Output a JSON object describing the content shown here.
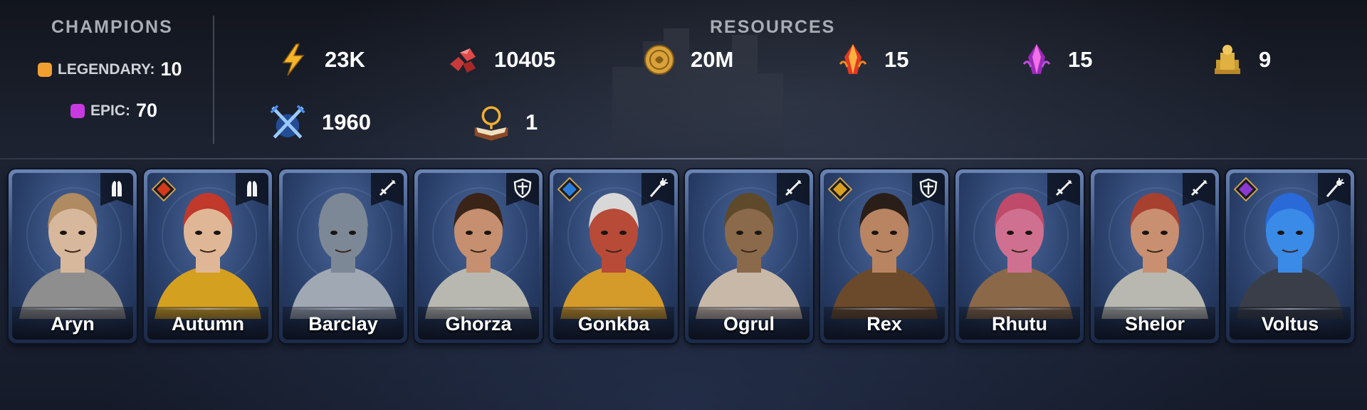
{
  "champions": {
    "title": "CHAMPIONS",
    "rarities": [
      {
        "label": "LEGENDARY:",
        "count": "10",
        "color": "#f0a030"
      },
      {
        "label": "EPIC:",
        "count": "70",
        "color": "#c73ae0"
      }
    ]
  },
  "resources": {
    "title": "RESOURCES",
    "items": [
      {
        "icon": "energy-bolt-icon",
        "value": "23K"
      },
      {
        "icon": "ruby-gems-icon",
        "value": "10405"
      },
      {
        "icon": "gold-coin-icon",
        "value": "20M"
      },
      {
        "icon": "fire-crystal-icon",
        "value": "15"
      },
      {
        "icon": "void-crystal-icon",
        "value": "15"
      },
      {
        "icon": "gold-statue-icon",
        "value": "9"
      },
      {
        "icon": "crossed-swords-icon",
        "value": "1960"
      },
      {
        "icon": "skill-tome-icon",
        "value": "1"
      }
    ]
  },
  "cards": [
    {
      "name": "Aryn",
      "role": "support",
      "affinity": null,
      "hair": "#b08a60",
      "skin": "#d8b89c",
      "garb": "#8e8e8e"
    },
    {
      "name": "Autumn",
      "role": "support",
      "affinity": "force",
      "hair": "#c0392b",
      "skin": "#e0b796",
      "garb": "#d4a020"
    },
    {
      "name": "Barclay",
      "role": "attack",
      "affinity": null,
      "hair": "#7d8896",
      "skin": "#7d8896",
      "garb": "#a0a8b4"
    },
    {
      "name": "Ghorza",
      "role": "defense",
      "affinity": null,
      "hair": "#3a2418",
      "skin": "#c58f70",
      "garb": "#b8b8b0"
    },
    {
      "name": "Gonkba",
      "role": "magic",
      "affinity": "magic",
      "hair": "#d8d8d8",
      "skin": "#b84a38",
      "garb": "#d49a2a"
    },
    {
      "name": "Ogrul",
      "role": "attack",
      "affinity": null,
      "hair": "#5e4a2a",
      "skin": "#8a6a4a",
      "garb": "#c8b8a8"
    },
    {
      "name": "Rex",
      "role": "defense",
      "affinity": "spirit",
      "hair": "#2a1f18",
      "skin": "#b88462",
      "garb": "#6a4a2a"
    },
    {
      "name": "Rhutu",
      "role": "attack",
      "affinity": null,
      "hair": "#c04a6a",
      "skin": "#d07090",
      "garb": "#8a6848"
    },
    {
      "name": "Shelor",
      "role": "attack",
      "affinity": null,
      "hair": "#a84030",
      "skin": "#c89070",
      "garb": "#b8b8b0"
    },
    {
      "name": "Voltus",
      "role": "magic",
      "affinity": "void",
      "hair": "#2a6ad8",
      "skin": "#3a8ae8",
      "garb": "#3a3e48"
    }
  ]
}
